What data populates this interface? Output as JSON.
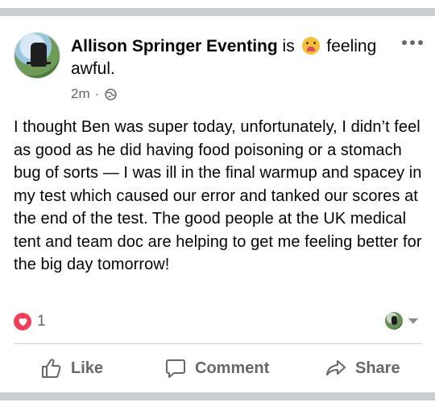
{
  "post": {
    "author": "Allison Springer Eventing",
    "activity_prefix": "is",
    "activity_suffix": "feeling awful.",
    "timestamp": "2m",
    "privacy_icon": "globe-icon",
    "text": "I thought Ben was super today, unfortunately, I didn’t feel as good as he did having food poisoning or a stomach bug of sorts — I was ill in the final warmup and spacey in my test which caused our error and tanked our scores at the end of the test. The good people at the UK medical tent and team doc are helping to get me feeling better for the big day tomorrow!",
    "reaction_count": "1"
  },
  "actions": {
    "like_label": "Like",
    "comment_label": "Comment",
    "share_label": "Share"
  },
  "colors": {
    "separator": "#c9ccd1",
    "secondary_text": "#65676b",
    "heart": "#f33e58"
  }
}
